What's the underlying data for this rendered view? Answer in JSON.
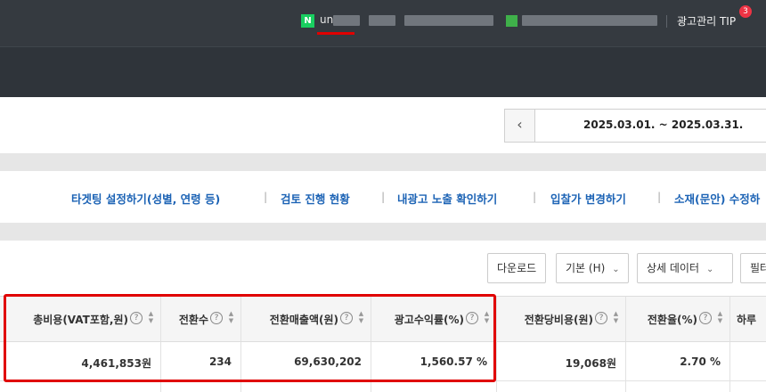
{
  "topbar": {
    "naver_badge": "N",
    "user_id": "un",
    "tip_label": "광고관리 TIP",
    "tip_count": "3"
  },
  "date_range": {
    "prev_icon": "chevron-left-icon",
    "value": "2025.03.01. ~ 2025.03.31."
  },
  "quick_links": [
    "타겟팅 설정하기(성별, 연령 등)",
    "검토 진행 현황",
    "내광고 노출 확인하기",
    "입찰가 변경하기",
    "소재(문안) 수정하"
  ],
  "toolbar": {
    "download_label": "다운로드",
    "basic_label": "기본 (H)",
    "detail_label": "상세 데이터",
    "filter_label": "필터"
  },
  "table": {
    "columns": [
      "총비용(VAT포함,원)",
      "전환수",
      "전환매출액(원)",
      "광고수익률(%)",
      "전환당비용(원)",
      "전환율(%)",
      "하루"
    ],
    "row": [
      "4,461,853원",
      "234",
      "69,630,202",
      "1,560.57 %",
      "19,068원",
      "2.70 %",
      ""
    ]
  },
  "colors": {
    "topbar": "#353a40",
    "link": "#1c63b5",
    "highlight": "#e00000",
    "naver_green": "#19ce60"
  }
}
